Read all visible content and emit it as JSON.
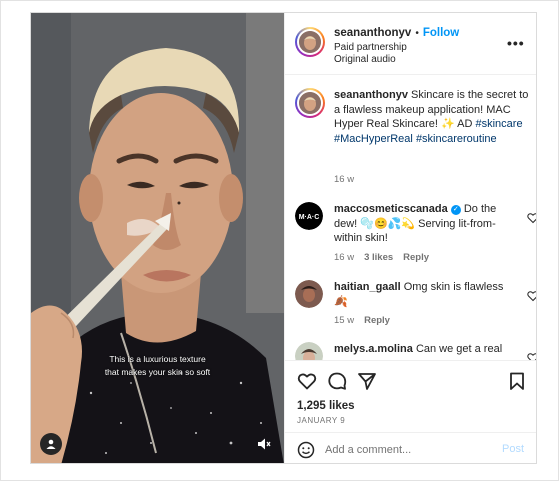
{
  "post": {
    "video_caption_lines": [
      "This is a luxurious texture",
      "that makes your skin so soft"
    ],
    "author": {
      "username": "seananthonyv",
      "follow_label": "Follow",
      "separator": "•",
      "subtitle_1": "Paid partnership",
      "subtitle_2": "Original audio"
    },
    "more_label": "•••",
    "caption": {
      "username": "seananthonyv",
      "text": "Skincare is the secret to a flawless makeup application! MAC Hyper Real Skincare! ✨ AD",
      "hashtags": [
        "#skincare",
        "#MacHyperReal",
        "#skincareroutine"
      ],
      "time": "16 w"
    },
    "comments": [
      {
        "username": "maccosmeticscanada",
        "verified": true,
        "text": "Do the dew! 🫧😊💦💫 Serving lit-from-within skin!",
        "time": "16 w",
        "likes": "3 likes",
        "reply": "Reply"
      },
      {
        "username": "haitian_gaall",
        "verified": false,
        "text": "Omg skin is flawless 🍂",
        "time": "15 w",
        "likes": "",
        "reply": "Reply"
      },
      {
        "username": "melys.a.molina",
        "verified": false,
        "text": "Can we get a real",
        "time": "",
        "likes": "",
        "reply": ""
      }
    ],
    "likes_count": "1,295 likes",
    "date": "JANUARY 9",
    "add_comment_placeholder": "Add a comment...",
    "post_label": "Post",
    "colors": {
      "accent": "#0095f6",
      "hashtag": "#00376b",
      "post_disabled": "#b3dbff",
      "meta": "#737373"
    },
    "icons": [
      "user-tag-icon",
      "mute-icon",
      "more-icon",
      "heart-icon",
      "comment-icon",
      "share-icon",
      "save-icon",
      "emoji-icon",
      "verified-badge-icon"
    ]
  }
}
